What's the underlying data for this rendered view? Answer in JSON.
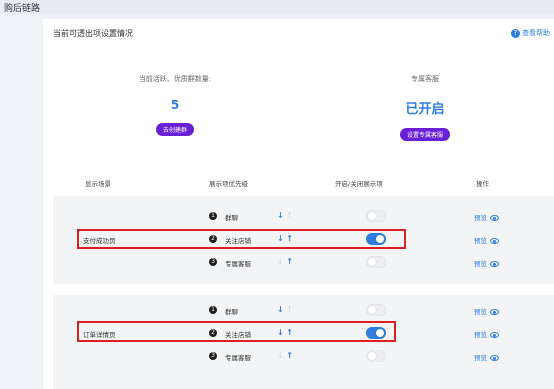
{
  "page": {
    "title": "购后链路"
  },
  "panel": {
    "title": "当前可透出项设置情况",
    "help_label": "查看帮助",
    "help_icon": "?"
  },
  "stats": {
    "active_groups": {
      "label": "当前活跃、优质群数量:",
      "value": "5",
      "button": "去创建群"
    },
    "exclusive_service": {
      "label": "专属客服",
      "value": "已开启",
      "button": "设置专属客服"
    }
  },
  "table": {
    "headers": [
      "显示场景",
      "展示项优先级",
      "开启/关闭展示项",
      "操作"
    ],
    "groups": [
      {
        "scene": "支付成功页",
        "rows": [
          {
            "num": "1",
            "label": "群聊",
            "down": "↓",
            "up": "↑",
            "up_dim": true,
            "down_dim": false,
            "enabled": false,
            "preview": "预览"
          },
          {
            "num": "2",
            "label": "关注店铺",
            "down": "↓",
            "up": "↑",
            "up_dim": false,
            "down_dim": false,
            "enabled": true,
            "preview": "预览"
          },
          {
            "num": "3",
            "label": "专属客服",
            "down": "↓",
            "up": "↑",
            "up_dim": false,
            "down_dim": true,
            "enabled": false,
            "preview": "预览"
          }
        ]
      },
      {
        "scene": "订单详情页",
        "rows": [
          {
            "num": "1",
            "label": "群聊",
            "down": "↓",
            "up": "↑",
            "up_dim": true,
            "down_dim": false,
            "enabled": false,
            "preview": "预览"
          },
          {
            "num": "2",
            "label": "关注店铺",
            "down": "↓",
            "up": "↑",
            "up_dim": false,
            "down_dim": false,
            "enabled": true,
            "preview": "预览"
          },
          {
            "num": "3",
            "label": "专属客服",
            "down": "↓",
            "up": "↑",
            "up_dim": false,
            "down_dim": true,
            "enabled": false,
            "preview": "预览"
          }
        ]
      }
    ]
  },
  "colors": {
    "accent": "#2f7de1",
    "purple": "#6a1fd6",
    "highlight": "#e02020"
  }
}
